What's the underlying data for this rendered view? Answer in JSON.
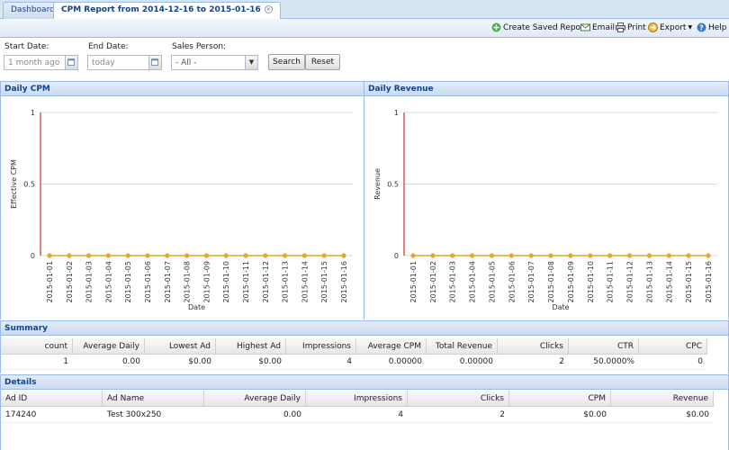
{
  "tabs": [
    {
      "label": "Dashboard",
      "active": false
    },
    {
      "label": "CPM Report from 2014-12-16 to 2015-01-16",
      "active": true
    }
  ],
  "toolbar": {
    "create_saved_report": "Create Saved Report",
    "email": "Email",
    "print": "Print",
    "export": "Export",
    "help": "Help"
  },
  "filters": {
    "start_date_label": "Start Date:",
    "start_date_value": "1 month ago",
    "end_date_label": "End Date:",
    "end_date_value": "today",
    "sales_person_label": "Sales Person:",
    "sales_person_value": "- All -",
    "search_label": "Search",
    "reset_label": "Reset"
  },
  "panels": {
    "daily_cpm": "Daily CPM",
    "daily_revenue": "Daily Revenue",
    "summary": "Summary",
    "details": "Details"
  },
  "colors": {
    "axis_line": "#cc0000",
    "series_line": "#f0a030",
    "series_point": "#f0a030",
    "header_text": "#15428b"
  },
  "chart_data": [
    {
      "type": "line",
      "title": "Daily CPM",
      "xlabel": "Date",
      "ylabel": "Effective CPM",
      "ylim": [
        0,
        1
      ],
      "yticks": [
        0,
        0.5,
        1
      ],
      "x": [
        "2015-01-01",
        "2015-01-02",
        "2015-01-03",
        "2015-01-04",
        "2015-01-05",
        "2015-01-06",
        "2015-01-07",
        "2015-01-08",
        "2015-01-09",
        "2015-01-10",
        "2015-01-11",
        "2015-01-12",
        "2015-01-13",
        "2015-01-14",
        "2015-01-15",
        "2015-01-16"
      ],
      "series": [
        {
          "values": [
            0,
            0,
            0,
            0,
            0,
            0,
            0,
            0,
            0,
            0,
            0,
            0,
            0,
            0,
            0,
            0
          ]
        }
      ],
      "grid": true
    },
    {
      "type": "line",
      "title": "Daily Revenue",
      "xlabel": "Date",
      "ylabel": "Revenue",
      "ylim": [
        0,
        1
      ],
      "yticks": [
        0,
        0.5,
        1
      ],
      "x": [
        "2015-01-01",
        "2015-01-02",
        "2015-01-03",
        "2015-01-04",
        "2015-01-05",
        "2015-01-06",
        "2015-01-07",
        "2015-01-08",
        "2015-01-09",
        "2015-01-10",
        "2015-01-11",
        "2015-01-12",
        "2015-01-13",
        "2015-01-14",
        "2015-01-15",
        "2015-01-16"
      ],
      "series": [
        {
          "values": [
            0,
            0,
            0,
            0,
            0,
            0,
            0,
            0,
            0,
            0,
            0,
            0,
            0,
            0,
            0,
            0
          ]
        }
      ],
      "grid": true
    }
  ],
  "summary": {
    "columns": [
      "count",
      "Average Daily",
      "Lowest Ad",
      "Highest Ad",
      "Impressions",
      "Average CPM",
      "Total Revenue",
      "Clicks",
      "CTR",
      "CPC"
    ],
    "row": [
      "1",
      "0.00",
      "$0.00",
      "$0.00",
      "4",
      "0.00000",
      "0.00000",
      "2",
      "50.0000%",
      "0"
    ]
  },
  "details": {
    "columns": [
      "Ad ID",
      "Ad Name",
      "Average Daily",
      "Impressions",
      "Clicks",
      "CPM",
      "Revenue"
    ],
    "rows": [
      [
        "174240",
        "Test 300x250",
        "0.00",
        "4",
        "2",
        "$0.00",
        "$0.00"
      ]
    ]
  }
}
